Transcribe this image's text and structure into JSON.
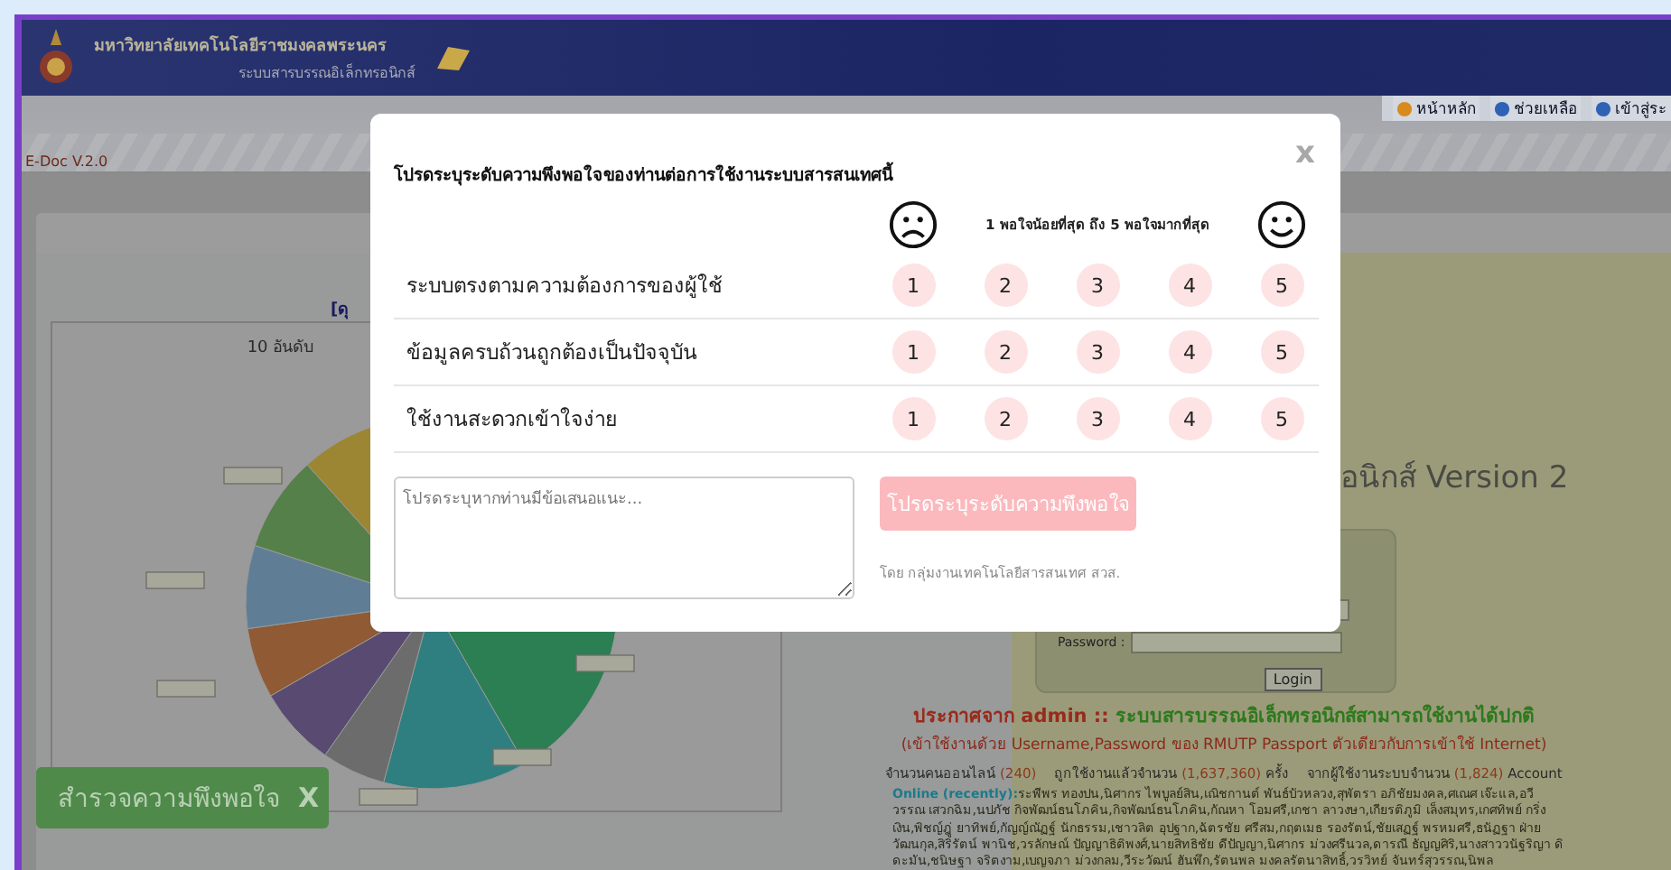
{
  "header": {
    "university": "มหาวิทยาลัยเทคโนโลยีราชมงคลพระนคร",
    "system": "ระบบสารบรรณอิเล็กทรอนิกส์",
    "nav": [
      {
        "label": "หน้าหลัก",
        "color": "#d98a1c"
      },
      {
        "label": "ช่วยเหลือ",
        "color": "#2f62b5"
      },
      {
        "label": "เข้าสู่ระ",
        "color": "#2f62b5"
      }
    ]
  },
  "version_bar": {
    "label": "E-Doc V.2.0"
  },
  "chart_panel": {
    "heading": "[ดุ",
    "chart_title": "10 อันดับ"
  },
  "login_panel": {
    "heading": "อนิกส์ Version 2",
    "password_label": "Password :",
    "login_button": "Login",
    "announcement_label": "ประกาศจาก admin ::",
    "announcement_message": "ระบบสารบรรณอิเล็กทรอนิกส์สามารถใช้งานได้ปกติ",
    "announcement_note": "(เข้าใช้งานด้วย Username,Password ของ RMUTP Passport ตัวเดียวกับการเข้าใช้ Internet)",
    "stats": [
      {
        "label": "จำนวนคนออนไลน์",
        "value": "(240)"
      },
      {
        "label": "ถูกใช้งานแล้วจำนวน",
        "value": "(1,637,360)",
        "unit": "ครั้ง"
      },
      {
        "label": "จากผู้ใช้งานระบบจำนวน",
        "value": "(1,824)",
        "unit": "Account"
      }
    ],
    "online_label": "Online (recently):",
    "online_names": "ระพีพร ทองปน,นิศากร ไพบูลย์สิน,เณิชกานต์ พันธ์บัวหลวง,สุพัตรา อภิชัยมงคล,ศเณศ เจ๊ะแล,อวีวรรณ เสวกฉิม,นปภัช กิจพัฒน์ธนโภคิน,กิจพัฒน์ธนโภคิน,กัณหา โอมศรี,เกชา ลาวงษา,เกียรติภูมิ เล็งสมุทร,เกศทิพย์ กริ่งเงิน,พิชญ์ฎู่ ยาทิพย์,กัญญ์ณัฏฐ์ นักธรรม,เชาวลิต อุปฐาก,ฉัตรชัย ศรีสม,กฤตเมธ รองรัตน์,ชัยเสฏฐ์ พรหมศรี,ธนัฏฐา ฝ่ายวัฒนกุล,สิริรัตน์ พานิช,วรลักษณ์ ปัญญาธิติพงศ์,นายสิทธิชัย ดีปัญญา,นิศากร ม่วงศรีนวล,ดารณี ธัญญศิริ,นางสาววนัฐริญา ดิดะมัน,ชนิษฐา จริตงาม,เบญจภา ม่วงกลม,วีระวัฒน์ ฮันพึก,รัตนพล มงคลรัตนาสิทธิ์,วรวิทย์ จันทร์สุวรรณ,นิพล"
  },
  "survey_tab": {
    "label": "สำรวจความพึงพอใจ",
    "close": "X"
  },
  "survey_modal": {
    "close": "x",
    "title": "โปรดระบุระดับความพึงพอใจของท่านต่อการใช้งานระบบสารสนเทศนี้",
    "scale_label": "1 พอใจน้อยที่สุด ถึง 5 พอใจมากที่สุด",
    "questions": [
      {
        "label": "ระบบตรงตามความต้องการของผู้ใช้",
        "options": [
          {
            "label": "1",
            "selected": false
          },
          {
            "label": "2",
            "selected": false
          },
          {
            "label": "3",
            "selected": false
          },
          {
            "label": "4",
            "selected": false
          },
          {
            "label": "5",
            "selected": false
          }
        ]
      },
      {
        "label": "ข้อมูลครบถ้วนถูกต้องเป็นปัจจุบัน",
        "options": [
          {
            "label": "1",
            "selected": false
          },
          {
            "label": "2",
            "selected": false
          },
          {
            "label": "3",
            "selected": false
          },
          {
            "label": "4",
            "selected": false
          },
          {
            "label": "5",
            "selected": false
          }
        ]
      },
      {
        "label": "ใช้งานสะดวกเข้าใจง่าย",
        "options": [
          {
            "label": "1",
            "selected": false
          },
          {
            "label": "2",
            "selected": false
          },
          {
            "label": "3",
            "selected": false
          },
          {
            "label": "4",
            "selected": false
          },
          {
            "label": "5",
            "selected": false
          }
        ]
      }
    ],
    "comment": {
      "placeholder": "โปรดระบุหากท่านมีข้อเสนอแนะ..."
    },
    "submit": {
      "label": "โปรดระบุระดับความพึงพอใจ",
      "disabled": true
    },
    "credit": "โดย กลุ่มงานเทคโนโลยีสารสนเทศ สวส."
  }
}
